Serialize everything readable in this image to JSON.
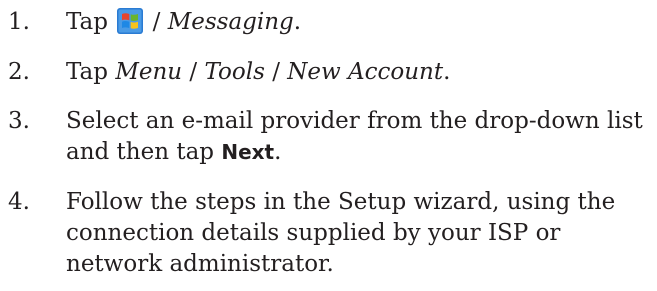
{
  "steps": [
    {
      "number": "1.",
      "segments": [
        {
          "text": "Tap ",
          "style": "normal"
        },
        {
          "icon": "windows-start-icon"
        },
        {
          "text": " / ",
          "style": "normal"
        },
        {
          "text": "Messaging",
          "style": "italic"
        },
        {
          "text": ".",
          "style": "normal"
        }
      ]
    },
    {
      "number": "2.",
      "segments": [
        {
          "text": "Tap ",
          "style": "normal"
        },
        {
          "text": "Menu",
          "style": "italic"
        },
        {
          "text": " / ",
          "style": "normal"
        },
        {
          "text": "Tools",
          "style": "italic"
        },
        {
          "text": " / ",
          "style": "normal"
        },
        {
          "text": "New Account",
          "style": "italic"
        },
        {
          "text": ".",
          "style": "normal"
        }
      ]
    },
    {
      "number": "3.",
      "segments": [
        {
          "text": "Select an e-mail provider from the drop-down list and then tap ",
          "style": "normal"
        },
        {
          "text": "Next",
          "style": "bold-ui"
        },
        {
          "text": ".",
          "style": "normal"
        }
      ]
    },
    {
      "number": "4.",
      "segments": [
        {
          "text": "Follow the steps in the Setup wizard, using the connection details supplied by your ISP or network administrator.",
          "style": "normal"
        }
      ]
    }
  ],
  "colors": {
    "text": "#231f20",
    "start_icon_red": "#e8452c",
    "start_icon_green": "#6ab42d",
    "start_icon_blue": "#1e88e5",
    "start_icon_yellow": "#f7c31b",
    "start_icon_bg": "#2a7bd3"
  }
}
